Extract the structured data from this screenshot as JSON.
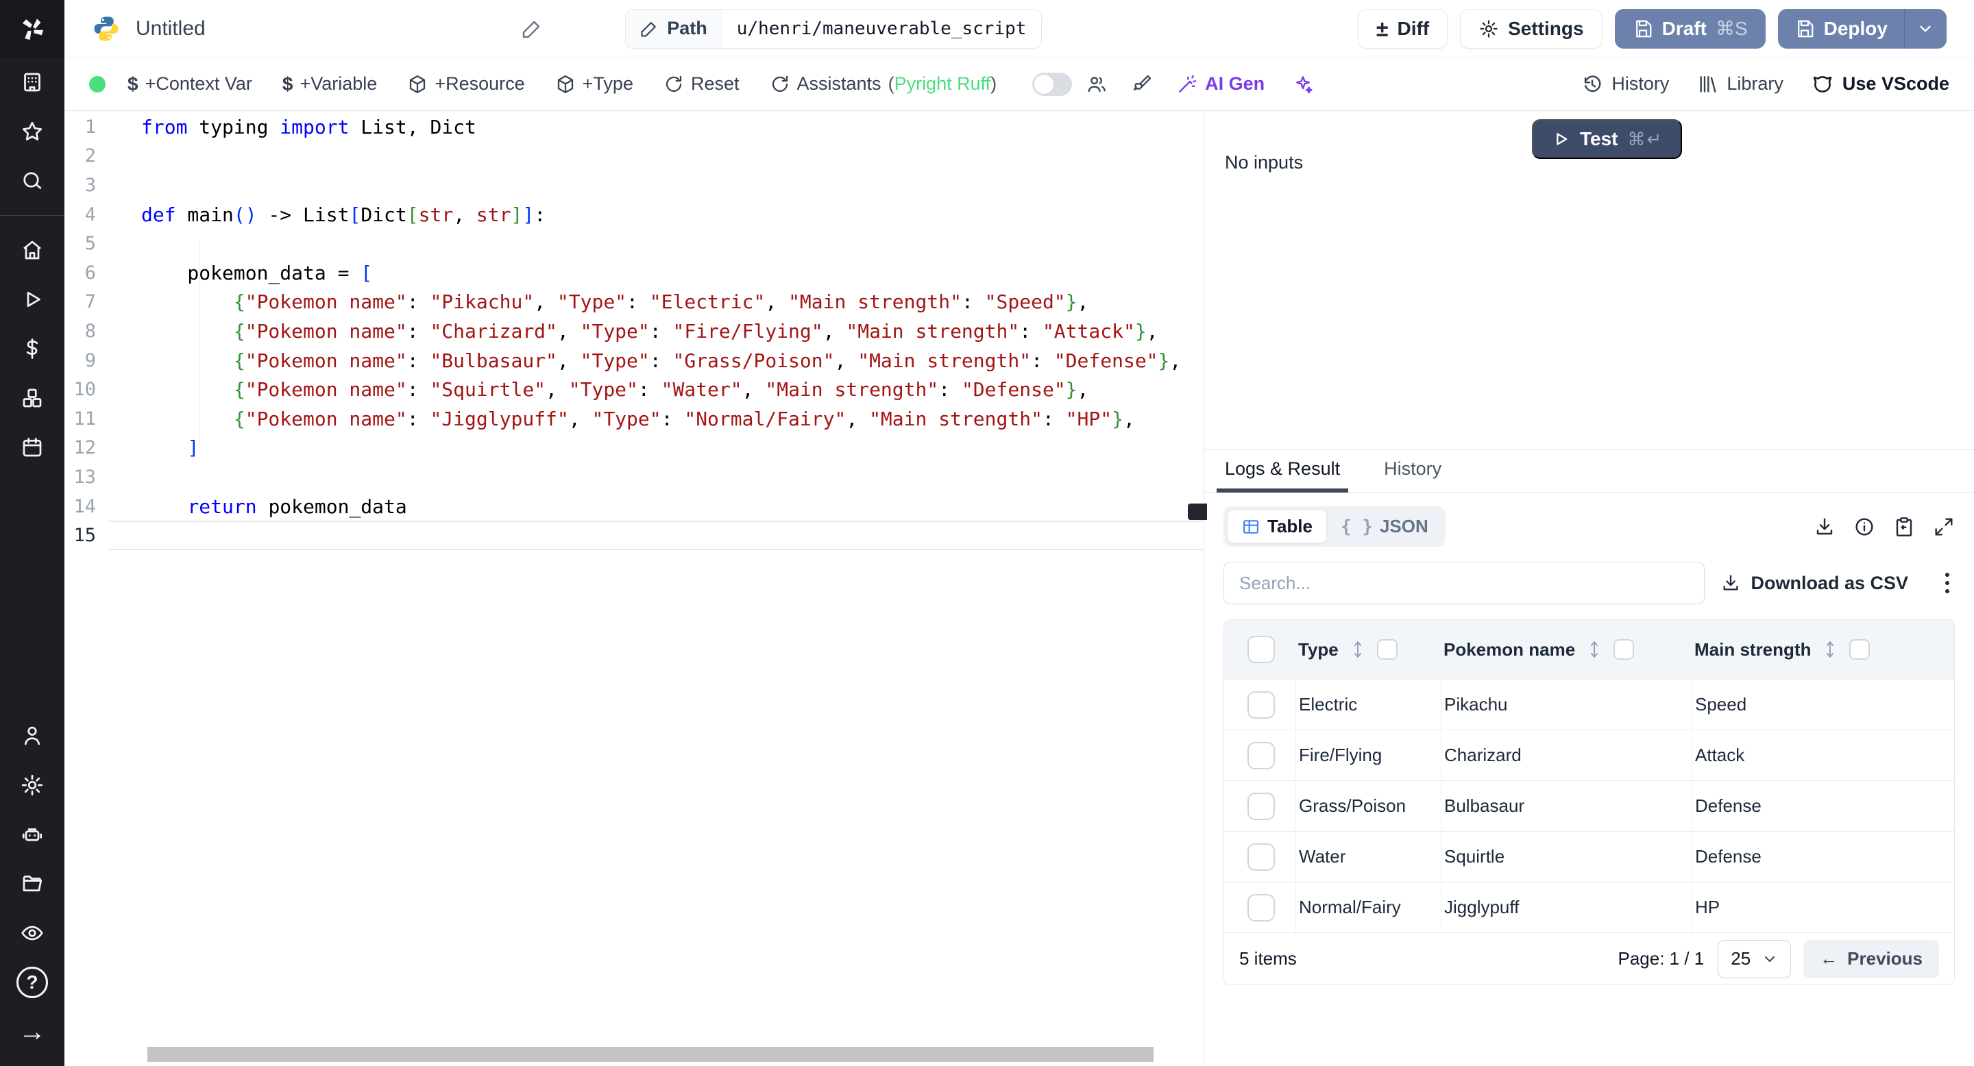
{
  "colors": {
    "accent_blue": "#3b82f6",
    "success_green": "#4ade80",
    "ai_purple": "#7c3aed",
    "primary_button": "#3e4c6a",
    "deploy_button": "#6c82ad",
    "code_keyword": "#0000ff",
    "code_string": "#a31515"
  },
  "header": {
    "title": "Untitled",
    "path_label": "Path",
    "path_value": "u/henri/maneuverable_script",
    "diff": "Diff",
    "settings": "Settings",
    "draft": "Draft",
    "draft_kbd": "⌘S",
    "deploy": "Deploy"
  },
  "toolbar": {
    "context_var": "+Context Var",
    "variable": "+Variable",
    "resource": "+Resource",
    "type": "+Type",
    "reset": "Reset",
    "assistants": "Assistants",
    "assistants_paren_l": "(",
    "assistants_lang": "Pyright Ruff",
    "assistants_paren_r": ")",
    "ai_gen": "AI Gen",
    "history": "History",
    "library": "Library",
    "vscode": "Use VScode"
  },
  "run": {
    "test": "Test",
    "test_kbd": "⌘↵",
    "no_inputs": "No inputs"
  },
  "result": {
    "tab_logs": "Logs & Result",
    "tab_history": "History",
    "view_table": "Table",
    "view_json": "JSON",
    "search_placeholder": "Search...",
    "download_csv": "Download as CSV"
  },
  "table": {
    "columns": [
      "Type",
      "Pokemon name",
      "Main strength"
    ],
    "rows": [
      {
        "type": "Electric",
        "name": "Pikachu",
        "strength": "Speed"
      },
      {
        "type": "Fire/Flying",
        "name": "Charizard",
        "strength": "Attack"
      },
      {
        "type": "Grass/Poison",
        "name": "Bulbasaur",
        "strength": "Defense"
      },
      {
        "type": "Water",
        "name": "Squirtle",
        "strength": "Defense"
      },
      {
        "type": "Normal/Fairy",
        "name": "Jigglypuff",
        "strength": "HP"
      }
    ],
    "footer": {
      "items": "5 items",
      "page": "Page: 1 / 1",
      "page_size": "25",
      "previous": "Previous",
      "prev_arrow": "←"
    }
  },
  "editor": {
    "active_line": 15,
    "lines": [
      {
        "n": 1,
        "toks": [
          [
            "k",
            "from"
          ],
          [
            "p",
            " typing "
          ],
          [
            "k",
            "import"
          ],
          [
            "p",
            " List, Dict"
          ]
        ]
      },
      {
        "n": 2,
        "toks": []
      },
      {
        "n": 3,
        "toks": []
      },
      {
        "n": 4,
        "toks": [
          [
            "k",
            "def"
          ],
          [
            "p",
            " main"
          ],
          [
            "b1",
            "()"
          ],
          [
            "p",
            " -> List"
          ],
          [
            "b1",
            "["
          ],
          [
            "p",
            "Dict"
          ],
          [
            "b2",
            "["
          ],
          [
            "t",
            "str"
          ],
          [
            "p",
            ", "
          ],
          [
            "t",
            "str"
          ],
          [
            "b2",
            "]"
          ],
          [
            "b1",
            "]"
          ],
          [
            "p",
            ":"
          ]
        ]
      },
      {
        "n": 5,
        "toks": []
      },
      {
        "n": 6,
        "toks": [
          [
            "p",
            "    pokemon_data = "
          ],
          [
            "b1",
            "["
          ]
        ]
      },
      {
        "n": 7,
        "toks": [
          [
            "p",
            "        "
          ],
          [
            "b2",
            "{"
          ],
          [
            "s",
            "\"Pokemon name\""
          ],
          [
            "p",
            ": "
          ],
          [
            "s",
            "\"Pikachu\""
          ],
          [
            "p",
            ", "
          ],
          [
            "s",
            "\"Type\""
          ],
          [
            "p",
            ": "
          ],
          [
            "s",
            "\"Electric\""
          ],
          [
            "p",
            ", "
          ],
          [
            "s",
            "\"Main strength\""
          ],
          [
            "p",
            ": "
          ],
          [
            "s",
            "\"Speed\""
          ],
          [
            "b2",
            "}"
          ],
          [
            "p",
            ","
          ]
        ]
      },
      {
        "n": 8,
        "toks": [
          [
            "p",
            "        "
          ],
          [
            "b2",
            "{"
          ],
          [
            "s",
            "\"Pokemon name\""
          ],
          [
            "p",
            ": "
          ],
          [
            "s",
            "\"Charizard\""
          ],
          [
            "p",
            ", "
          ],
          [
            "s",
            "\"Type\""
          ],
          [
            "p",
            ": "
          ],
          [
            "s",
            "\"Fire/Flying\""
          ],
          [
            "p",
            ", "
          ],
          [
            "s",
            "\"Main strength\""
          ],
          [
            "p",
            ": "
          ],
          [
            "s",
            "\"Attack\""
          ],
          [
            "b2",
            "}"
          ],
          [
            "p",
            ","
          ]
        ]
      },
      {
        "n": 9,
        "toks": [
          [
            "p",
            "        "
          ],
          [
            "b2",
            "{"
          ],
          [
            "s",
            "\"Pokemon name\""
          ],
          [
            "p",
            ": "
          ],
          [
            "s",
            "\"Bulbasaur\""
          ],
          [
            "p",
            ", "
          ],
          [
            "s",
            "\"Type\""
          ],
          [
            "p",
            ": "
          ],
          [
            "s",
            "\"Grass/Poison\""
          ],
          [
            "p",
            ", "
          ],
          [
            "s",
            "\"Main strength\""
          ],
          [
            "p",
            ": "
          ],
          [
            "s",
            "\"Defense\""
          ],
          [
            "b2",
            "}"
          ],
          [
            "p",
            ","
          ]
        ]
      },
      {
        "n": 10,
        "toks": [
          [
            "p",
            "        "
          ],
          [
            "b2",
            "{"
          ],
          [
            "s",
            "\"Pokemon name\""
          ],
          [
            "p",
            ": "
          ],
          [
            "s",
            "\"Squirtle\""
          ],
          [
            "p",
            ", "
          ],
          [
            "s",
            "\"Type\""
          ],
          [
            "p",
            ": "
          ],
          [
            "s",
            "\"Water\""
          ],
          [
            "p",
            ", "
          ],
          [
            "s",
            "\"Main strength\""
          ],
          [
            "p",
            ": "
          ],
          [
            "s",
            "\"Defense\""
          ],
          [
            "b2",
            "}"
          ],
          [
            "p",
            ","
          ]
        ]
      },
      {
        "n": 11,
        "toks": [
          [
            "p",
            "        "
          ],
          [
            "b2",
            "{"
          ],
          [
            "s",
            "\"Pokemon name\""
          ],
          [
            "p",
            ": "
          ],
          [
            "s",
            "\"Jigglypuff\""
          ],
          [
            "p",
            ", "
          ],
          [
            "s",
            "\"Type\""
          ],
          [
            "p",
            ": "
          ],
          [
            "s",
            "\"Normal/Fairy\""
          ],
          [
            "p",
            ", "
          ],
          [
            "s",
            "\"Main strength\""
          ],
          [
            "p",
            ": "
          ],
          [
            "s",
            "\"HP\""
          ],
          [
            "b2",
            "}"
          ],
          [
            "p",
            ","
          ]
        ]
      },
      {
        "n": 12,
        "toks": [
          [
            "p",
            "    "
          ],
          [
            "b1",
            "]"
          ]
        ]
      },
      {
        "n": 13,
        "toks": []
      },
      {
        "n": 14,
        "toks": [
          [
            "p",
            "    "
          ],
          [
            "k",
            "return"
          ],
          [
            "p",
            " pokemon_data"
          ]
        ]
      },
      {
        "n": 15,
        "toks": []
      }
    ]
  }
}
